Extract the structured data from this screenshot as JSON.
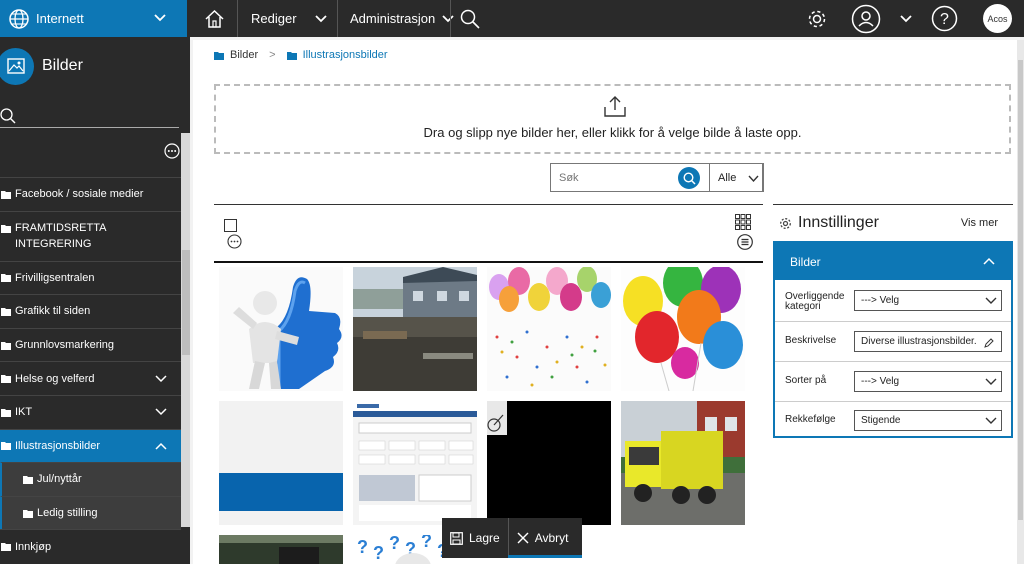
{
  "topbar": {
    "site_label": "Internett",
    "edit_label": "Rediger",
    "admin_label": "Administrasjon",
    "avatar_text": "Acos"
  },
  "sidebar": {
    "title": "Bilder",
    "search_placeholder": "",
    "items": [
      {
        "label": "Facebook / sosiale medier"
      },
      {
        "label": "FRAMTIDSRETTA INTEGRERING"
      },
      {
        "label": "Frivilligsentralen"
      },
      {
        "label": "Grafikk til siden"
      },
      {
        "label": "Grunnlovsmarkering"
      },
      {
        "label": "Helse og velferd"
      },
      {
        "label": "IKT"
      },
      {
        "label": "Illustrasjonsbilder"
      },
      {
        "label": "Jul/nyttår"
      },
      {
        "label": "Ledig stilling"
      },
      {
        "label": "Innkjøp"
      }
    ]
  },
  "breadcrumb": {
    "root": "Bilder",
    "separator": ">",
    "current": "Illustrasjonsbilder"
  },
  "dropzone": {
    "text": "Dra og slipp nye bilder her, eller klikk for å velge bilde å laste opp."
  },
  "search": {
    "placeholder": "Søk",
    "filter_value": "Alle"
  },
  "settings": {
    "title": "Innstillinger",
    "more_label": "Vis mer",
    "panel_title": "Bilder",
    "fields": {
      "parent_label": "Overliggende kategori",
      "parent_value": "---> Velg",
      "description_label": "Beskrivelse",
      "description_value": "Diverse illustrasjonsbilder.",
      "sort_label": "Sorter på",
      "sort_value": "---> Velg",
      "order_label": "Rekkefølge",
      "order_value": "Stigende"
    }
  },
  "actions": {
    "save_label": "Lagre",
    "cancel_label": "Avbryt"
  },
  "colors": {
    "brand": "#0d77b5",
    "dark": "#2a2a2a"
  }
}
